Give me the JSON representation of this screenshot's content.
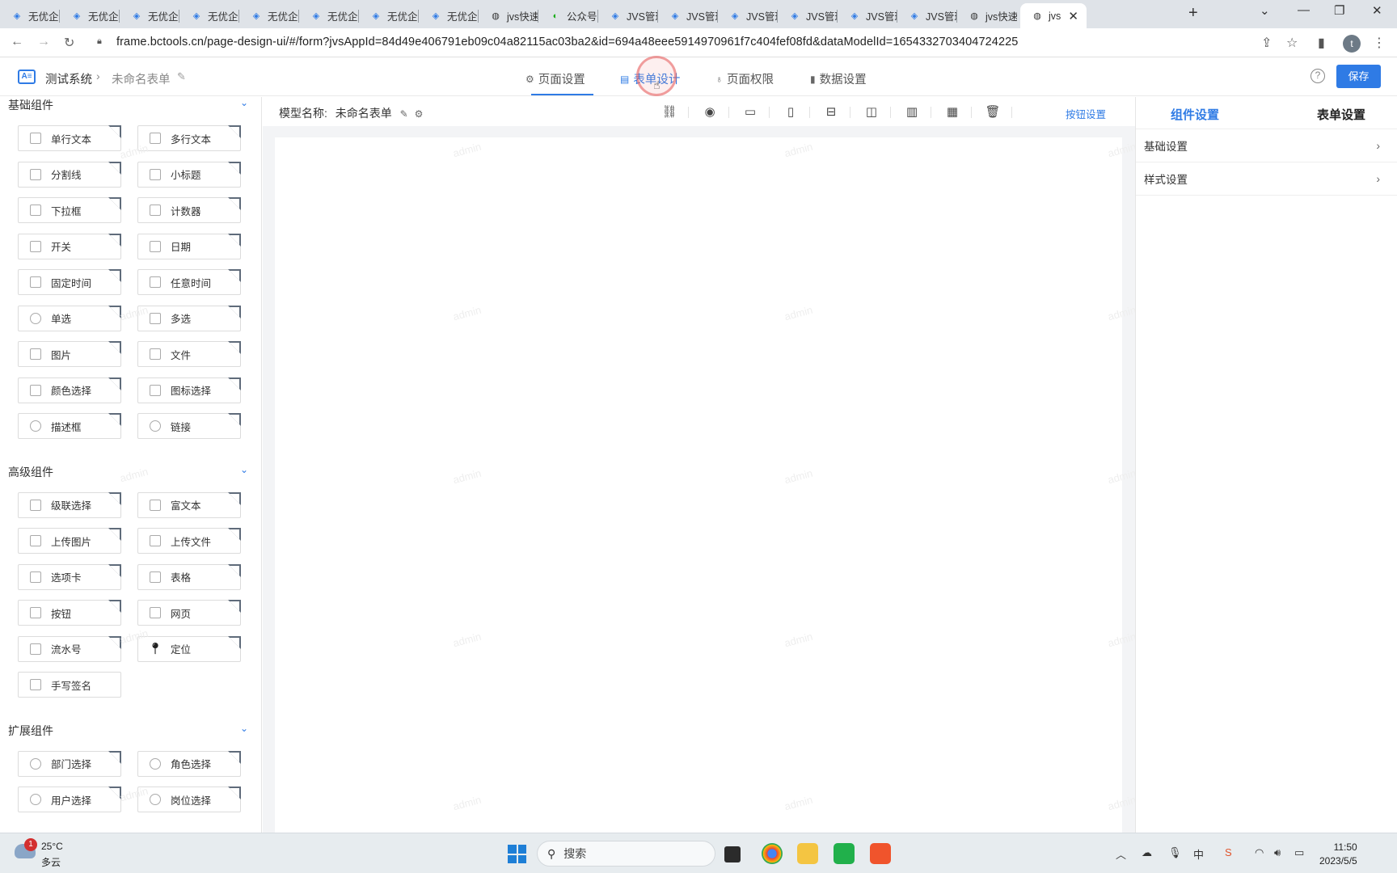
{
  "browser": {
    "tabs": [
      {
        "title": "无优企",
        "icon": "app-logo"
      },
      {
        "title": "无优企",
        "icon": "app-logo"
      },
      {
        "title": "无优企",
        "icon": "app-logo"
      },
      {
        "title": "无优企",
        "icon": "app-logo"
      },
      {
        "title": "无优企",
        "icon": "app-logo"
      },
      {
        "title": "无优企",
        "icon": "app-logo"
      },
      {
        "title": "无优企",
        "icon": "app-logo"
      },
      {
        "title": "无优企",
        "icon": "app-logo"
      },
      {
        "title": "jvs快速",
        "icon": "globe"
      },
      {
        "title": "公众号",
        "icon": "wechat"
      },
      {
        "title": "JVS管理",
        "icon": "app-logo"
      },
      {
        "title": "JVS管理",
        "icon": "app-logo"
      },
      {
        "title": "JVS管理",
        "icon": "app-logo"
      },
      {
        "title": "JVS管理",
        "icon": "app-logo"
      },
      {
        "title": "JVS管理",
        "icon": "app-logo"
      },
      {
        "title": "JVS管理",
        "icon": "app-logo"
      },
      {
        "title": "jvs快速",
        "icon": "globe"
      },
      {
        "title": "jvs",
        "icon": "globe"
      }
    ],
    "url": "frame.bctools.cn/page-design-ui/#/form?jvsAppId=84d49e406791eb09c04a82115ac03ba2&id=694a48eee5914970961f7c404fef08fd&dataModelId=1654332703404724225",
    "profile_initial": "t"
  },
  "header": {
    "app_name": "测试系统",
    "form_name": "未命名表单",
    "nav_tabs": [
      {
        "label": "页面设置",
        "icon": "gear-icon"
      },
      {
        "label": "表单设计",
        "icon": "document-icon"
      },
      {
        "label": "页面权限",
        "icon": "lock-icon"
      },
      {
        "label": "数据设置",
        "icon": "bar-chart-icon"
      }
    ],
    "active_tab": "表单设计",
    "save_label": "保存"
  },
  "palette": {
    "watermark": "admin",
    "sections": [
      {
        "title": "基础组件",
        "items": [
          "单行文本",
          "多行文本",
          "分割线",
          "小标题",
          "下拉框",
          "计数器",
          "开关",
          "日期",
          "固定时间",
          "任意时间",
          "单选",
          "多选",
          "图片",
          "文件",
          "颜色选择",
          "图标选择",
          "描述框",
          "链接"
        ]
      },
      {
        "title": "高级组件",
        "items": [
          "级联选择",
          "富文本",
          "上传图片",
          "上传文件",
          "选项卡",
          "表格",
          "按钮",
          "网页",
          "流水号",
          "定位",
          "手写签名"
        ]
      },
      {
        "title": "扩展组件",
        "items": [
          "部门选择",
          "角色选择",
          "用户选择",
          "岗位选择"
        ]
      }
    ]
  },
  "canvas": {
    "model_label": "模型名称:",
    "model_name": "未命名表单",
    "button_settings": "按钮设置"
  },
  "right_panel": {
    "tabs": [
      "组件设置",
      "表单设置"
    ],
    "active_tab": "组件设置",
    "items": [
      "基础设置",
      "样式设置"
    ]
  },
  "taskbar": {
    "weather_badge": "1",
    "temperature": "25°C",
    "condition": "多云",
    "search_placeholder": "搜索",
    "ime": "中",
    "time": "11:50",
    "date": "2023/5/5"
  },
  "colors": {
    "accent": "#2f7be5",
    "save_button": "#2f7be5"
  }
}
